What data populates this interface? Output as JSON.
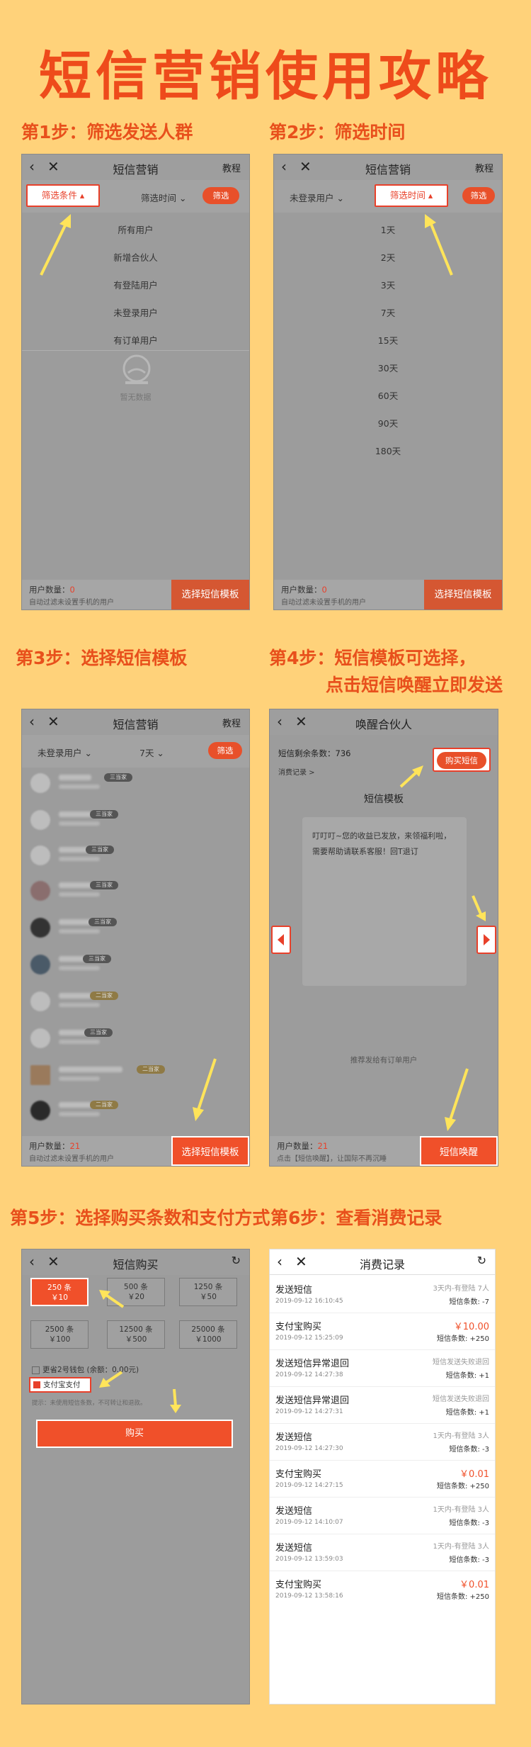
{
  "main_title": "短信营销使用攻略",
  "steps": {
    "s1": "第1步：筛选发送人群",
    "s2": "第2步：筛选时间",
    "s3": "第3步：选择短信模板",
    "s4_line1": "第4步：短信模板可选择，",
    "s4_line2": "点击短信唤醒立即发送",
    "s5": "第5步：选择购买条数和支付方式",
    "s6": "第6步：查看消费记录"
  },
  "common": {
    "back": "‹",
    "close": "✕",
    "nav_title": "短信营销",
    "nav_right": "教程",
    "filter_btn": "筛选",
    "filter_cond": "筛选条件",
    "filter_time": "筛选时间",
    "user_count_label": "用户数量：",
    "auto_hint": "自动过滤未设置手机的用户",
    "choose_tpl": "选择短信模板",
    "refresh_icon": "↻"
  },
  "phone1": {
    "count": "0",
    "menu": [
      "所有用户",
      "新增合伙人",
      "有登陆用户",
      "未登录用户",
      "有订单用户"
    ],
    "empty": "暂无数据"
  },
  "phone2": {
    "selected_group": "未登录用户",
    "count": "0",
    "menu": [
      "1天",
      "2天",
      "3天",
      "7天",
      "15天",
      "30天",
      "60天",
      "90天",
      "180天"
    ]
  },
  "phone3": {
    "selected_group": "未登录用户",
    "selected_time": "7天",
    "count": "21",
    "tags": [
      "三当家",
      "三当家",
      "三当家",
      "三当家",
      "三当家",
      "三当家",
      "二当家",
      "三当家",
      "二当家",
      "二当家"
    ]
  },
  "phone4": {
    "nav_title": "唤醒合伙人",
    "remain": "短信剩余条数：736",
    "record_link": "消费记录 >",
    "buy_btn": "购买短信",
    "tpl_title": "短信模板",
    "tpl_text": "叮叮叮~您的收益已发放，来领福利啦，需要帮助请联系客服！回T退订",
    "recommend": "推荐发给有订单用户",
    "count": "21",
    "hint": "点击【短信唤醒】，让国际不再沉睡",
    "wake_btn": "短信唤醒"
  },
  "phone5": {
    "nav_title": "短信购买",
    "packages": [
      {
        "qty": "250 条",
        "price": "￥10"
      },
      {
        "qty": "500 条",
        "price": "￥20"
      },
      {
        "qty": "1250 条",
        "price": "￥50"
      },
      {
        "qty": "2500 条",
        "price": "￥100"
      },
      {
        "qty": "12500 条",
        "price": "￥500"
      },
      {
        "qty": "25000 条",
        "price": "￥1000"
      }
    ],
    "wallet": "更省2号钱包 (余额：0.00元)",
    "alipay": "支付宝支付",
    "tip": "提示：未使用短信条数，不可转让和退款。",
    "buy": "购买"
  },
  "phone6": {
    "nav_title": "消费记录",
    "records": [
      {
        "title": "发送短信",
        "date": "2019-09-12 16:10:45",
        "r1": "3天内-有登陆 7人",
        "r2": "短信条数: -7",
        "money": false
      },
      {
        "title": "支付宝购买",
        "date": "2019-09-12 15:25:09",
        "r1": "￥10.00",
        "r2": "短信条数: +250",
        "money": true
      },
      {
        "title": "发送短信异常退回",
        "date": "2019-09-12 14:27:38",
        "r1": "短信发送失败退回",
        "r2": "短信条数: +1",
        "money": false
      },
      {
        "title": "发送短信异常退回",
        "date": "2019-09-12 14:27:31",
        "r1": "短信发送失败退回",
        "r2": "短信条数: +1",
        "money": false
      },
      {
        "title": "发送短信",
        "date": "2019-09-12 14:27:30",
        "r1": "1天内-有登陆 3人",
        "r2": "短信条数: -3",
        "money": false
      },
      {
        "title": "支付宝购买",
        "date": "2019-09-12 14:27:15",
        "r1": "￥0.01",
        "r2": "短信条数: +250",
        "money": true
      },
      {
        "title": "发送短信",
        "date": "2019-09-12 14:10:07",
        "r1": "1天内-有登陆 3人",
        "r2": "短信条数: -3",
        "money": false
      },
      {
        "title": "发送短信",
        "date": "2019-09-12 13:59:03",
        "r1": "1天内-有登陆 3人",
        "r2": "短信条数: -3",
        "money": false
      },
      {
        "title": "支付宝购买",
        "date": "2019-09-12 13:58:16",
        "r1": "￥0.01",
        "r2": "短信条数: +250",
        "money": true
      }
    ]
  }
}
